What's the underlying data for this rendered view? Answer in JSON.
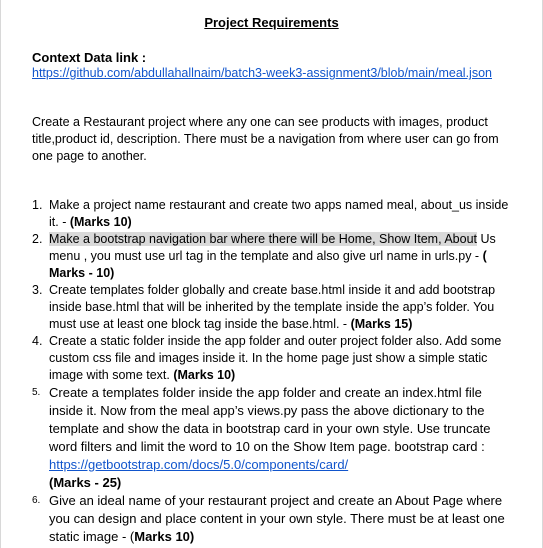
{
  "title": "Project Requirements",
  "context": {
    "heading": "Context Data link :",
    "url": "https://github.com/abdullahallnaim/batch3-week3-assignment3/blob/main/meal.json"
  },
  "intro": "Create a Restaurant project where any one can see products with images, product title,product id, description. There must be a navigation from where user can go from one page to another.",
  "requirements": [
    {
      "number": "1.",
      "text": "Make a project name restaurant and create two apps named meal, about_us inside it. - ",
      "marks": "(Marks 10)"
    },
    {
      "number": "2.",
      "text_highlighted": "Make a bootstrap navigation bar where there will be Home, Show Item, About",
      "text": "Us menu , you must use url tag in the template and also give url name in urls.py   - ",
      "marks": "( Marks - 10)"
    },
    {
      "number": "3.",
      "text": "Create templates folder globally and create base.html inside it and add bootstrap inside base.html that will be inherited by the template inside the app’s folder. You must use at least one block tag inside the base.html. - ",
      "marks": "(Marks 15)"
    },
    {
      "number": "4.",
      "text": "Create a static folder inside the app folder and outer project folder also. Add some custom css file and images inside it. In the home page just show a simple static image with some text. ",
      "marks": "(Marks 10)"
    },
    {
      "number": "5.",
      "text": "Create a templates folder inside the app folder and create an index.html file inside it.  Now from the meal app’s views.py pass the above dictionary to the template and show the data in bootstrap card in your own style. Use truncate word filters and limit the word to 10 on the Show Item page. bootstrap card : ",
      "link": "https://getbootstrap.com/docs/5.0/components/card/",
      "marks": "(Marks - 25)"
    },
    {
      "number": "6.",
      "text": "Give an ideal name of your restaurant project and create an About Page where you can design and place content in your own style. There must be at least one static image - (",
      "marks": "Marks 10)"
    }
  ]
}
